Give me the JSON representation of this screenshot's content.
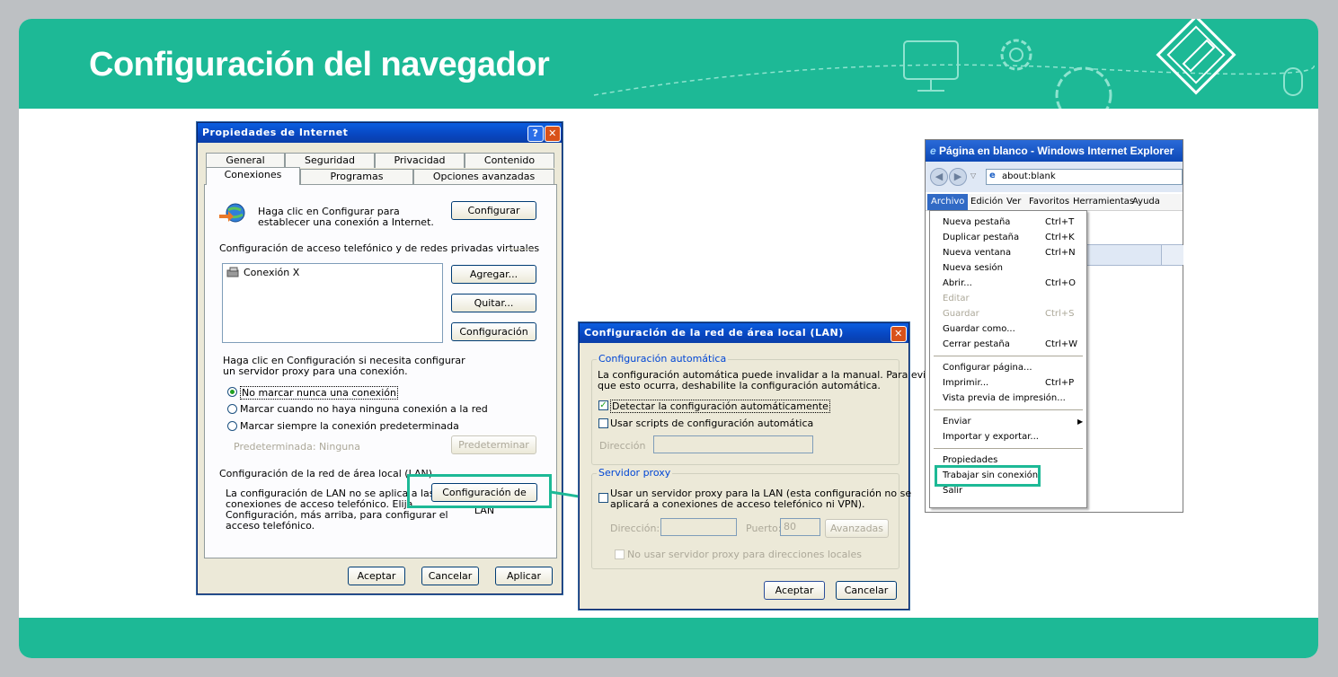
{
  "slide": {
    "title": "Configuración del navegador"
  },
  "colors": {
    "accent": "#1db996",
    "background": "#bdc0c3",
    "xp_title": "#0846c0",
    "xp_face": "#ece9d8"
  },
  "internet_properties": {
    "title": "Propiedades de Internet",
    "tabs_row1": [
      "General",
      "Seguridad",
      "Privacidad",
      "Contenido"
    ],
    "tabs_row2": [
      "Conexiones",
      "Programas",
      "Opciones avanzadas"
    ],
    "setup_text_1": "Haga clic en Configurar para",
    "setup_text_2": "establecer una conexión a Internet.",
    "setup_button": "Configurar",
    "dialup_header": "Configuración de acceso telefónico y de redes privadas virtuales",
    "connections": [
      "Conexión X"
    ],
    "add_button": "Agregar...",
    "remove_button": "Quitar...",
    "settings_button": "Configuración",
    "proxy_text_1": "Haga clic en Configuración si necesita configurar",
    "proxy_text_2": "un servidor proxy para una conexión.",
    "radio_never": "No marcar nunca una conexión",
    "radio_when_none": "Marcar cuando no haya ninguna conexión a la red",
    "radio_always": "Marcar siempre la conexión predeterminada",
    "default_label": "Predeterminada: Ninguna",
    "default_button": "Predeterminar",
    "lan_header": "Configuración de la red de área local (LAN)",
    "lan_text_1": "La configuración de LAN no se aplica a las",
    "lan_text_2": "conexiones de acceso telefónico. Elija",
    "lan_text_3": "Configuración, más arriba, para configurar el",
    "lan_text_4": "acceso telefónico.",
    "lan_button": "Configuración de LAN",
    "ok": "Aceptar",
    "cancel": "Cancelar",
    "apply": "Aplicar"
  },
  "lan_dialog": {
    "title": "Configuración de la red de área local (LAN)",
    "auto_group": "Configuración automática",
    "auto_text_1": "La configuración automática puede invalidar a la manual. Para evitar",
    "auto_text_2": "que esto ocurra, deshabilite la configuración automática.",
    "detect_checkbox": "Detectar la configuración automáticamente",
    "script_checkbox": "Usar scripts de configuración automática",
    "address_label": "Dirección",
    "proxy_group": "Servidor proxy",
    "proxy_checkbox_1": "Usar un servidor proxy para la LAN (esta configuración no se",
    "proxy_checkbox_2": "aplicará a conexiones de acceso telefónico ni VPN).",
    "proxy_address_label": "Dirección:",
    "port_label": "Puerto:",
    "port_value": "80",
    "advanced_button": "Avanzadas",
    "bypass_checkbox": "No usar servidor proxy para direcciones locales",
    "ok": "Aceptar",
    "cancel": "Cancelar"
  },
  "ie_window": {
    "title": "Página en blanco - Windows Internet Explorer",
    "address": "about:blank",
    "menu": [
      "Archivo",
      "Edición",
      "Ver",
      "Favoritos",
      "Herramientas",
      "Ayuda"
    ],
    "file_menu": [
      {
        "label": "Nueva pestaña",
        "shortcut": "Ctrl+T"
      },
      {
        "label": "Duplicar pestaña",
        "shortcut": "Ctrl+K"
      },
      {
        "label": "Nueva ventana",
        "shortcut": "Ctrl+N"
      },
      {
        "label": "Nueva sesión",
        "shortcut": ""
      },
      {
        "label": "Abrir...",
        "shortcut": "Ctrl+O"
      },
      {
        "label": "Editar",
        "shortcut": ""
      },
      {
        "label": "Guardar",
        "shortcut": "Ctrl+S"
      },
      {
        "label": "Guardar como...",
        "shortcut": ""
      },
      {
        "label": "Cerrar pestaña",
        "shortcut": "Ctrl+W"
      },
      {
        "label": "Configurar página...",
        "shortcut": ""
      },
      {
        "label": "Imprimir...",
        "shortcut": "Ctrl+P"
      },
      {
        "label": "Vista previa de impresión...",
        "shortcut": ""
      },
      {
        "label": "Enviar",
        "shortcut": ""
      },
      {
        "label": "Importar y exportar...",
        "shortcut": ""
      },
      {
        "label": "Propiedades",
        "shortcut": ""
      },
      {
        "label": "Trabajar sin conexión",
        "shortcut": ""
      },
      {
        "label": "Salir",
        "shortcut": ""
      }
    ]
  }
}
